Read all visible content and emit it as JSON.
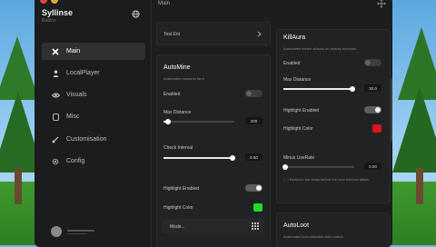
{
  "app": {
    "title": "Syllinse",
    "subtitle": "Roblox"
  },
  "colors": {
    "accent_green": "#1fdc2a",
    "accent_red": "#e01414",
    "traffic_red": "#e0453e",
    "traffic_orange": "#e8a23a"
  },
  "sidebar": {
    "items": [
      {
        "label": "Main",
        "icon": "x-icon",
        "active": true
      },
      {
        "label": "LocalPlayer",
        "icon": "person-icon",
        "active": false
      },
      {
        "label": "Visuals",
        "icon": "eye-icon",
        "active": false
      },
      {
        "label": "Misc",
        "icon": "box-icon",
        "active": false
      },
      {
        "label": "Customisation",
        "icon": "brush-icon",
        "active": false
      },
      {
        "label": "Config",
        "icon": "gear-icon",
        "active": false
      }
    ]
  },
  "header": {
    "title": "Main"
  },
  "left_column": {
    "test_entry": {
      "label": "Test Ent"
    },
    "automine": {
      "title": "AutoMine",
      "description": "Automates resource farm",
      "enabled_label": "Enabled",
      "enabled": false,
      "max_distance_label": "Max Distance",
      "max_distance_value": "200",
      "max_distance_fraction": 0.06,
      "check_interval_label": "Check Interval",
      "check_interval_value": "0.50",
      "check_interval_fraction": 0.98,
      "highlight_enabled_label": "Highlight Enabled",
      "highlight_enabled": true,
      "highlight_color_label": "Highlight Color",
      "highlight_color": "#1fdc2a",
      "mode_label": "Mode..."
    }
  },
  "right_column": {
    "killaura": {
      "title": "KillAura",
      "description": "Automates melee attacks on nearby enemies",
      "enabled_label": "Enabled",
      "enabled": false,
      "max_distance_label": "Max Distance",
      "max_distance_value": "30.0",
      "max_distance_fraction": 0.98,
      "highlight_enabled_label": "Highlight Enabled",
      "highlight_enabled": true,
      "highlight_color_label": "Highlight Color",
      "highlight_color": "#e01414",
      "minus_userate_label": "Minus UseRate",
      "minus_userate_value": "0.00",
      "minus_userate_fraction": 0.02,
      "minus_userate_note_tag": "[ ! ]",
      "minus_userate_note": "Reduces the delay before the next KillAura attack"
    },
    "autoloot": {
      "title": "AutoLoot",
      "description": "Automates loot collection from crates"
    }
  }
}
